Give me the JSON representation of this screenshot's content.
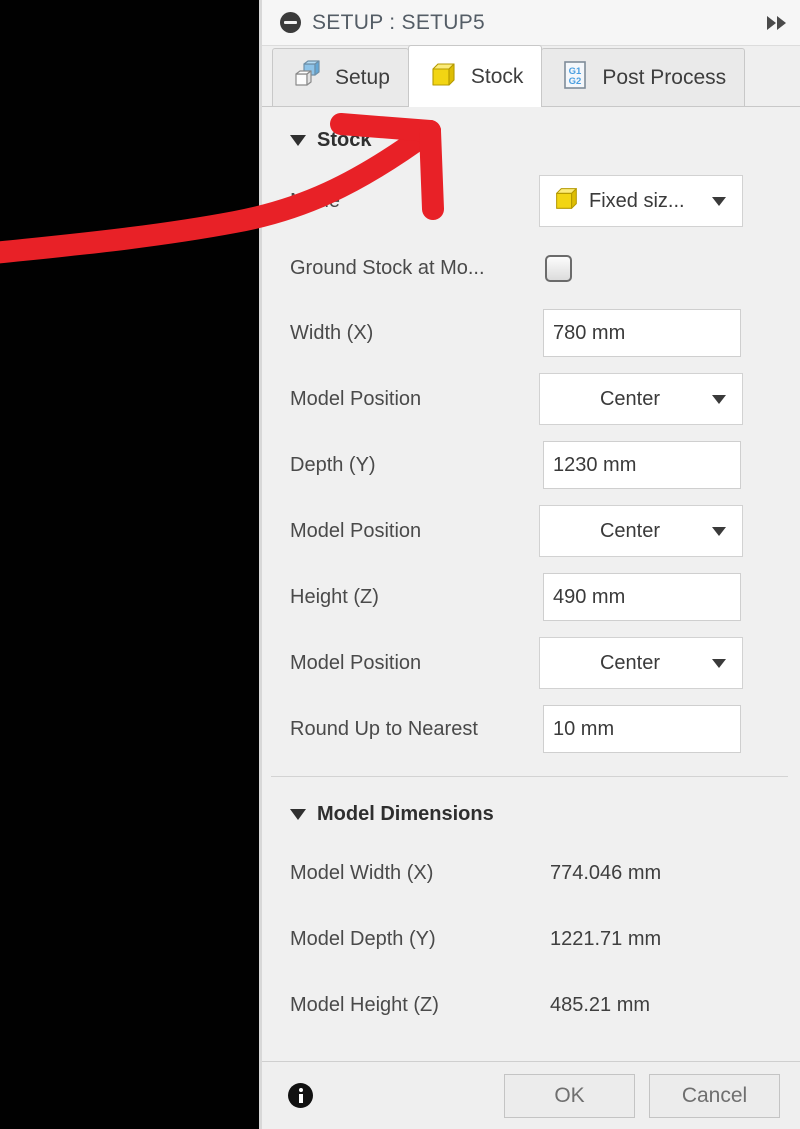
{
  "window": {
    "title": "SETUP : SETUP5",
    "collapse_icon": "collapse-circle-icon",
    "expand_icon": "double-chevron-right-icon"
  },
  "tabs": [
    {
      "label": "Setup",
      "icon": "setup-cube-icon",
      "active": false
    },
    {
      "label": "Stock",
      "icon": "stock-cube-icon",
      "active": true
    },
    {
      "label": "Post Process",
      "icon": "gcode-document-icon",
      "active": false
    }
  ],
  "stock_section": {
    "header": "Stock",
    "rows": {
      "mode": {
        "label": "Mode",
        "value": "Fixed siz...",
        "icon": "yellow-cube-icon"
      },
      "ground_stock": {
        "label": "Ground Stock at Mo...",
        "checked": false
      },
      "width_x": {
        "label": "Width (X)",
        "value": "780 mm"
      },
      "model_position_x": {
        "label": "Model Position",
        "value": "Center"
      },
      "depth_y": {
        "label": "Depth (Y)",
        "value": "1230 mm"
      },
      "model_position_y": {
        "label": "Model Position",
        "value": "Center"
      },
      "height_z": {
        "label": "Height (Z)",
        "value": "490 mm"
      },
      "model_position_z": {
        "label": "Model Position",
        "value": "Center"
      },
      "round_up": {
        "label": "Round Up to Nearest",
        "value": "10 mm"
      }
    }
  },
  "model_dimensions_section": {
    "header": "Model Dimensions",
    "items": [
      {
        "label": "Model Width (X)",
        "value": "774.046 mm"
      },
      {
        "label": "Model Depth (Y)",
        "value": "1221.71 mm"
      },
      {
        "label": "Model Height (Z)",
        "value": "485.21 mm"
      }
    ]
  },
  "footer": {
    "info_icon": "info-circle-icon",
    "ok_label": "OK",
    "cancel_label": "Cancel"
  },
  "annotation": {
    "type": "hand-drawn-arrow",
    "color": "#e82127"
  },
  "colors": {
    "panel_bg": "#f0f0f0",
    "viewport_bg": "#010101",
    "stock_yellow": "#f2d513",
    "annotation_red": "#e82127",
    "title_text": "#545d66"
  }
}
